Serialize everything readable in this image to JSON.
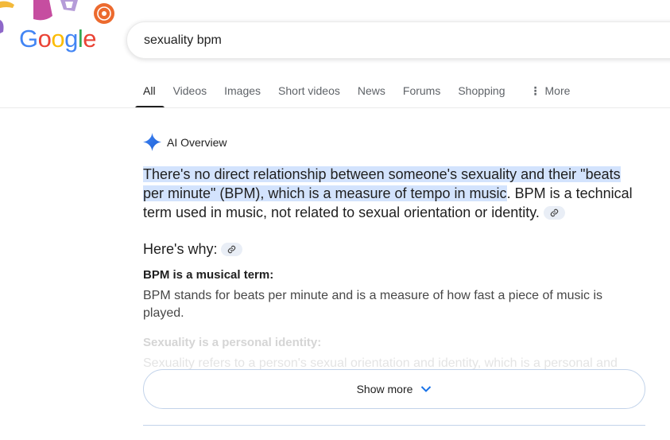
{
  "logo": {
    "letters": [
      "G",
      "o",
      "o",
      "g",
      "l",
      "e"
    ],
    "colors": [
      "#4285f4",
      "#ea4335",
      "#fbbc05",
      "#4285f4",
      "#34a853",
      "#ea4335"
    ]
  },
  "search": {
    "query": "sexuality bpm"
  },
  "tabs": [
    {
      "label": "All",
      "active": true
    },
    {
      "label": "Videos"
    },
    {
      "label": "Images"
    },
    {
      "label": "Short videos"
    },
    {
      "label": "News"
    },
    {
      "label": "Forums"
    },
    {
      "label": "Shopping"
    },
    {
      "label": "More",
      "icon": "more-vert-icon"
    }
  ],
  "ai_overview": {
    "title": "AI Overview",
    "icon": "gemini-sparkle-icon",
    "intro_highlighted": "There's no direct relationship between someone's sexuality and their \"beats per minute\" (BPM), which is a measure of tempo in music",
    "intro_rest": ". BPM is a technical term used in music, not related to sexual orientation or identity.",
    "heres_why": "Here's why:",
    "points": [
      {
        "title": "BPM is a musical term:",
        "text": "BPM stands for beats per minute and is a measure of how fast a piece of music is played."
      },
      {
        "title": "Sexuality is a personal identity:",
        "text": "Sexuality refers to a person's sexual orientation and identity, which is a personal and"
      }
    ],
    "show_more": "Show more"
  },
  "colors": {
    "accent_blue": "#1a73e8",
    "highlight": "#d3e3fd",
    "chip_bg": "#e9eef6",
    "border": "#c2d3ea"
  }
}
